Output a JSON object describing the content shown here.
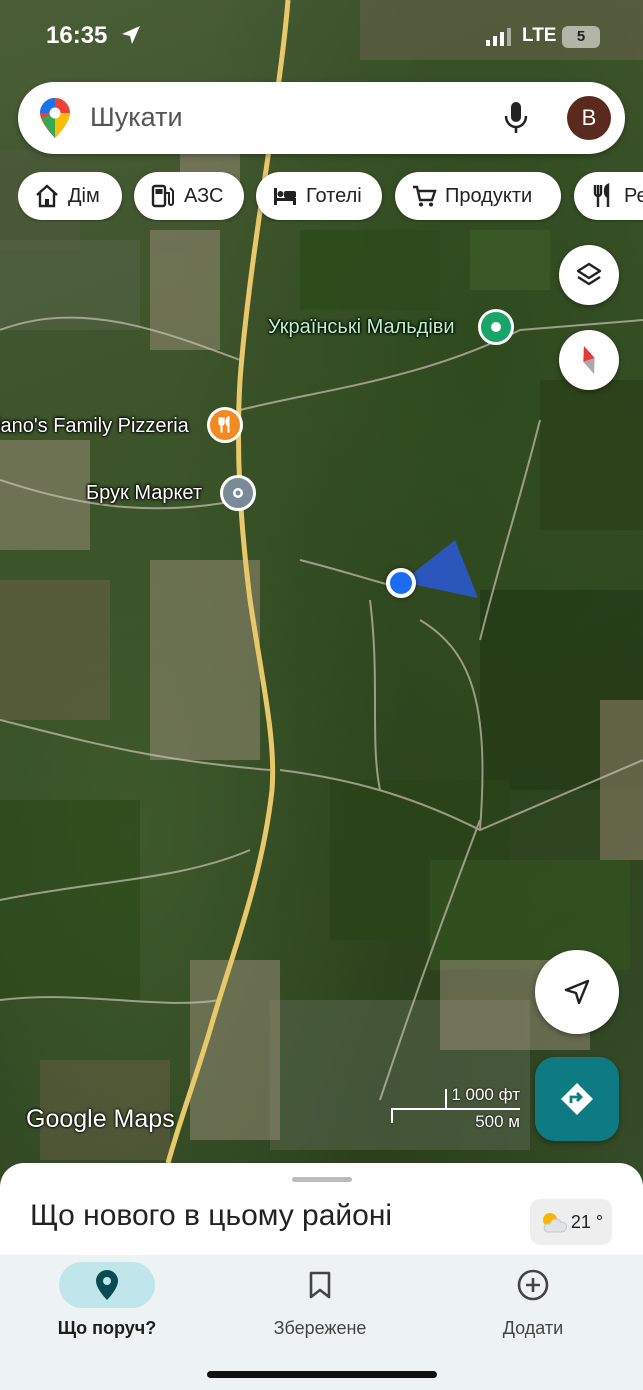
{
  "status_bar": {
    "time": "16:35",
    "network": "LTE",
    "battery": "5"
  },
  "search": {
    "placeholder": "Шукати",
    "avatar_letter": "B"
  },
  "chips": [
    {
      "label": "Дім",
      "icon": "home-icon"
    },
    {
      "label": "АЗС",
      "icon": "gas-station-icon"
    },
    {
      "label": "Готелі",
      "icon": "bed-icon"
    },
    {
      "label": "Продукти",
      "icon": "cart-icon"
    },
    {
      "label": "Ре",
      "icon": "restaurant-icon"
    }
  ],
  "map": {
    "places": [
      {
        "name": "Українські Мальдіви",
        "icon": "green-pin-icon",
        "color": "#19a56a"
      },
      {
        "name": "ciano's Family Pizzeria",
        "icon": "restaurant-icon",
        "color": "#f28a22"
      },
      {
        "name": "Брук Маркет",
        "icon": "store-pin-icon",
        "color": "#7a8a96"
      }
    ],
    "watermark": "Google Maps",
    "scale": {
      "feet": "1 000 фт",
      "meters": "500 м"
    }
  },
  "sheet": {
    "title": "Що нового в цьому районі",
    "weather": "21 °"
  },
  "nav": {
    "nearby": "Що поруч?",
    "saved": "Збережене",
    "add": "Додати"
  },
  "colors": {
    "accent": "#0e7b83",
    "nav_active": "#bfe6ea",
    "location_dot": "#1a6cf0"
  }
}
